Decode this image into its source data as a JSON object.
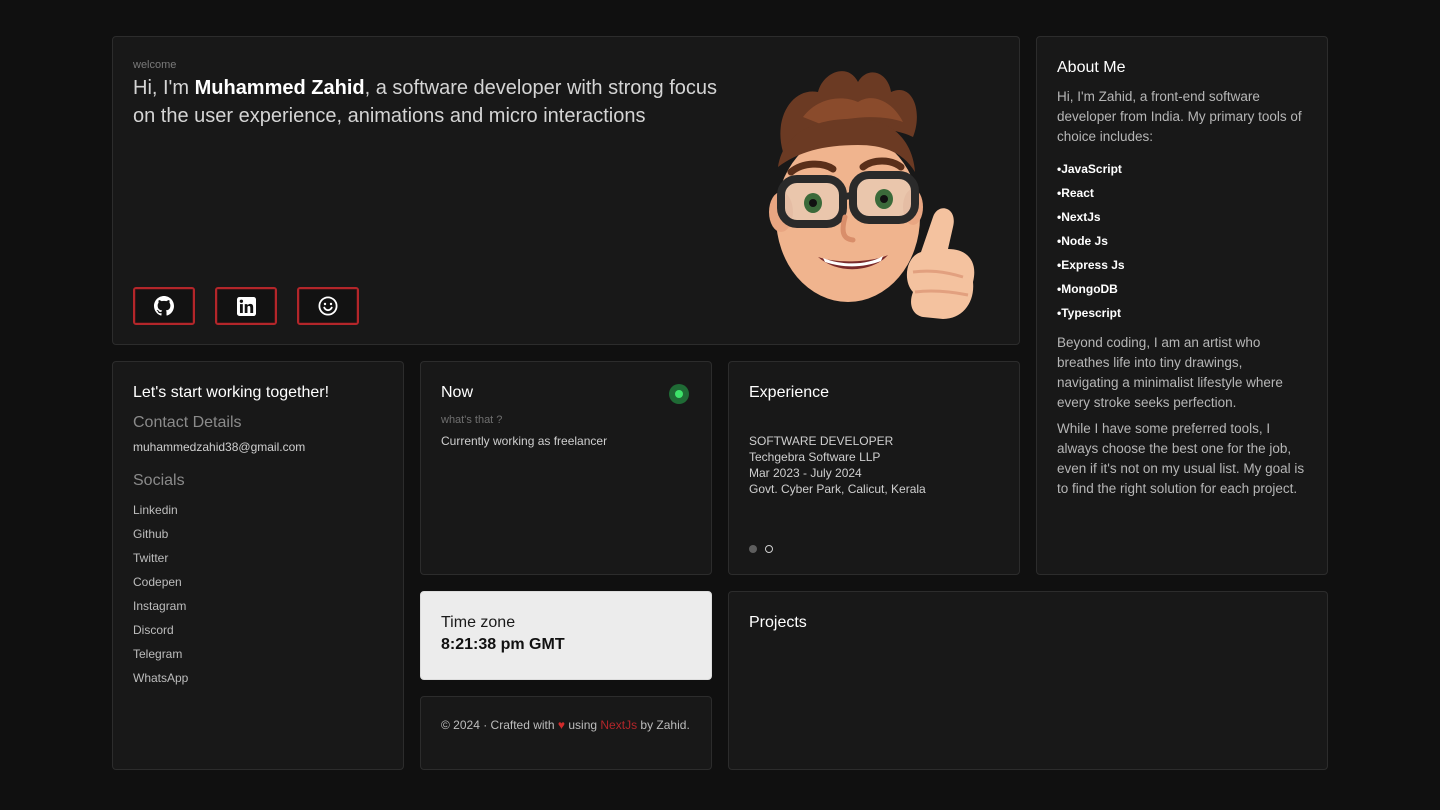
{
  "hero": {
    "welcome": "welcome",
    "intro_prefix": "Hi, I'm ",
    "name": "Muhammed Zahid",
    "intro_suffix": ", a software developer with strong focus on the user experience, animations and micro interactions",
    "buttons": [
      {
        "icon": "github-icon"
      },
      {
        "icon": "linkedin-icon"
      },
      {
        "icon": "smiley-icon"
      }
    ]
  },
  "about": {
    "title": "About Me",
    "intro": "Hi, I'm Zahid, a front-end software developer from India. My primary tools of choice includes:",
    "skills": [
      "JavaScript",
      "React",
      "NextJs",
      "Node Js",
      "Express Js",
      "MongoDB",
      "Typescript"
    ],
    "para1": "Beyond coding, I am an artist who breathes life into tiny drawings, navigating a minimalist lifestyle where every stroke seeks perfection.",
    "para2": "While I have some preferred tools, I always choose the best one for the job, even if it's not on my usual list. My goal is to find the right solution for each project."
  },
  "contact": {
    "title": "Let's start working together!",
    "details_heading": "Contact Details",
    "email": "muhammedzahid38@gmail.com",
    "socials_heading": "Socials",
    "socials": [
      "Linkedin",
      "Github",
      "Twitter",
      "Codepen",
      "Instagram",
      "Discord",
      "Telegram",
      "WhatsApp"
    ]
  },
  "now": {
    "title": "Now",
    "subtitle": "what's that ?",
    "text": "Currently working as freelancer",
    "status_color": "#3ee26a"
  },
  "experience": {
    "title": "Experience",
    "role": "SOFTWARE DEVELOPER",
    "company": "Techgebra Software LLP",
    "period": "Mar 2023 - July 2024",
    "location": "Govt. Cyber Park, Calicut, Kerala",
    "slides": 2,
    "active_slide": 1
  },
  "timezone": {
    "label": "Time zone",
    "value": "8:21:38 pm GMT"
  },
  "footer": {
    "prefix": "© 2024 · Crafted with ",
    "heart": "♥",
    "middle": " using ",
    "link": "NextJs",
    "suffix": " by Zahid."
  },
  "projects": {
    "title": "Projects"
  },
  "colors": {
    "accent": "#b3262a",
    "background": "#101010",
    "card": "#181818"
  }
}
